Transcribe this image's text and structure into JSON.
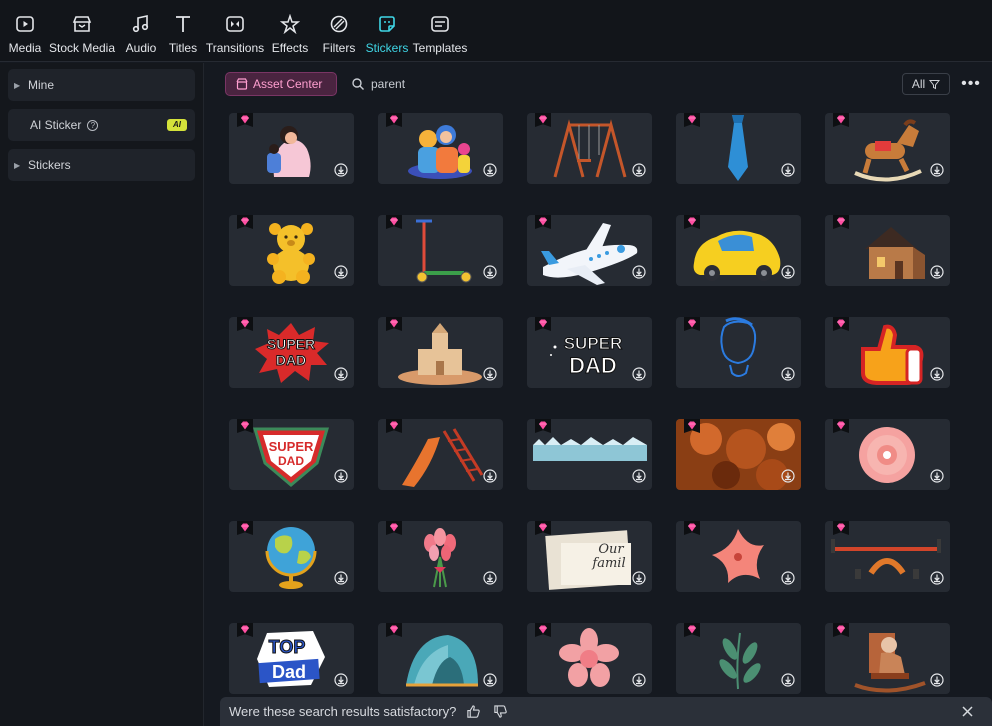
{
  "toolbar": {
    "items": [
      {
        "label": "Media",
        "icon": "media-icon"
      },
      {
        "label": "Stock Media",
        "icon": "stock-media-icon"
      },
      {
        "label": "Audio",
        "icon": "audio-icon"
      },
      {
        "label": "Titles",
        "icon": "titles-icon"
      },
      {
        "label": "Transitions",
        "icon": "transitions-icon"
      },
      {
        "label": "Effects",
        "icon": "effects-icon"
      },
      {
        "label": "Filters",
        "icon": "filters-icon"
      },
      {
        "label": "Stickers",
        "icon": "stickers-icon"
      },
      {
        "label": "Templates",
        "icon": "templates-icon"
      }
    ],
    "active": "Stickers",
    "accent_color": "#3fd6e6"
  },
  "sidebar": {
    "items": [
      {
        "label": "Mine",
        "expandable": true
      },
      {
        "label": "AI Sticker",
        "expandable": false,
        "badge": "AI"
      },
      {
        "label": "Stickers",
        "expandable": true
      }
    ]
  },
  "search": {
    "asset_center_label": "Asset Center",
    "query": "parent",
    "filter_label": "All"
  },
  "stickers": [
    {
      "name": "mother-child"
    },
    {
      "name": "family"
    },
    {
      "name": "swing-set"
    },
    {
      "name": "necktie"
    },
    {
      "name": "rocking-horse"
    },
    {
      "name": "teddy-bear"
    },
    {
      "name": "kick-scooter"
    },
    {
      "name": "airplane"
    },
    {
      "name": "toy-car"
    },
    {
      "name": "house"
    },
    {
      "name": "super-dad-burst",
      "text": [
        "SUPER",
        "DAD"
      ]
    },
    {
      "name": "sand-castle"
    },
    {
      "name": "super-dad-text",
      "text": [
        "SUPER",
        "DAD"
      ]
    },
    {
      "name": "man-outline"
    },
    {
      "name": "thumbs-up"
    },
    {
      "name": "super-dad-shield",
      "text": [
        "SUPER",
        "DAD"
      ]
    },
    {
      "name": "playground-slide"
    },
    {
      "name": "ice-strip"
    },
    {
      "name": "fire-rocks"
    },
    {
      "name": "pink-flower"
    },
    {
      "name": "globe"
    },
    {
      "name": "tulip-bouquet"
    },
    {
      "name": "our-family-card",
      "text": [
        "Our",
        "famil"
      ]
    },
    {
      "name": "pink-lily"
    },
    {
      "name": "seesaw"
    },
    {
      "name": "top-dad",
      "text": [
        "TOP",
        "Dad"
      ]
    },
    {
      "name": "play-tent"
    },
    {
      "name": "pink-daisy"
    },
    {
      "name": "green-leaves"
    },
    {
      "name": "grandma-rocking-chair"
    }
  ],
  "feedback": {
    "question": "Were these search results satisfactory?"
  },
  "colors": {
    "background": "#151920",
    "card": "#262b33",
    "premium_gem": "#ff4fa3"
  }
}
